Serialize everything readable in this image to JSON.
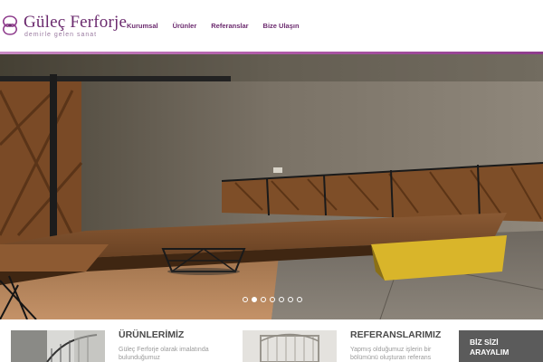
{
  "header": {
    "brand": "Güleç Ferforje",
    "tagline": "demirle gelen sanat",
    "logo_icon": "ornament-logo-icon",
    "nav": [
      {
        "label": "Kurumsal"
      },
      {
        "label": "Ürünler"
      },
      {
        "label": "Referanslar"
      },
      {
        "label": "Bize Ulaşın"
      }
    ]
  },
  "slider": {
    "slide_count": 7,
    "active_index": 1
  },
  "sections": {
    "products": {
      "title": "ÜRÜNLERİMİZ",
      "text": "Güleç Ferforje olarak imalatında bulunduğumuz"
    },
    "references": {
      "title": "REFERANSLARIMIZ",
      "text": "Yapmış olduğumuz işlerin bir bölümünü oluşturan referans"
    },
    "cta": {
      "label": "BİZ SİZİ ARAYALIM"
    }
  },
  "colors": {
    "brand": "#6b2a6e",
    "accent": "#b05aa8",
    "cta_bg": "#5b5b5b"
  }
}
